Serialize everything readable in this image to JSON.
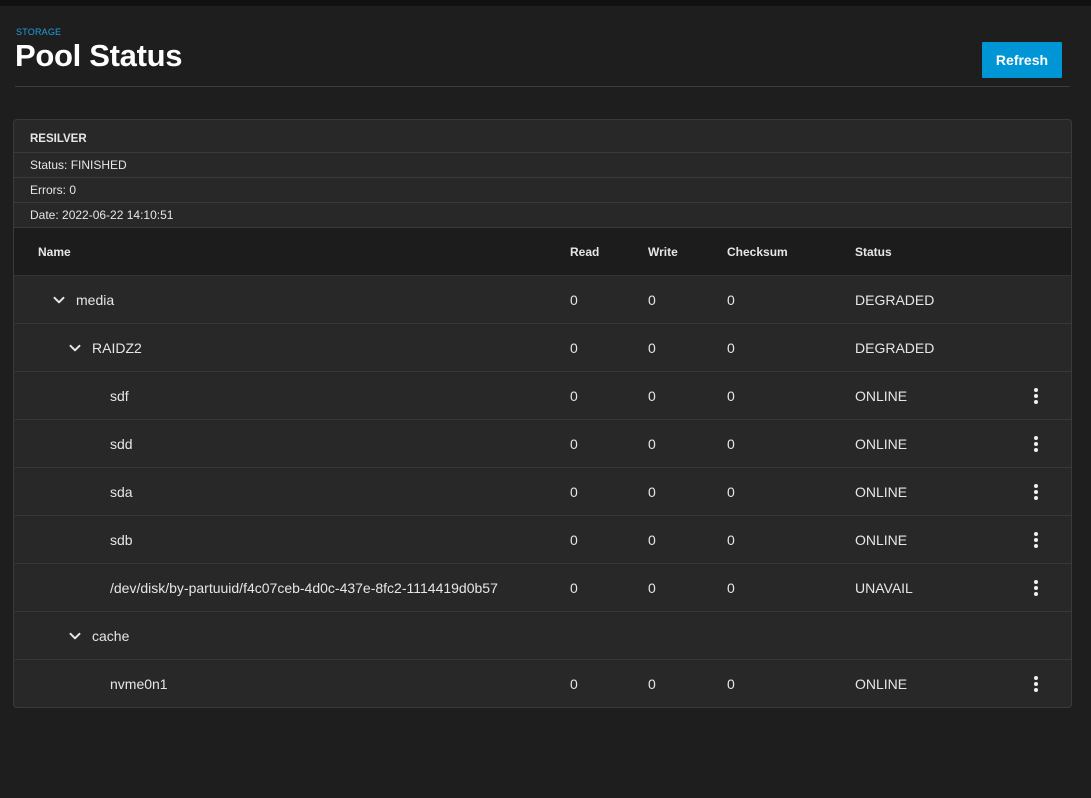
{
  "header": {
    "breadcrumb": "STORAGE",
    "title": "Pool Status",
    "refresh_label": "Refresh"
  },
  "resilver": {
    "title": "RESILVER",
    "status": "Status: FINISHED",
    "errors": "Errors: 0",
    "date": "Date: 2022-06-22 14:10:51"
  },
  "table": {
    "columns": {
      "name": "Name",
      "read": "Read",
      "write": "Write",
      "checksum": "Checksum",
      "status": "Status"
    },
    "rows": [
      {
        "name": "media",
        "level": 0,
        "expandable": true,
        "read": "0",
        "write": "0",
        "checksum": "0",
        "status": "DEGRADED",
        "menu": false
      },
      {
        "name": "RAIDZ2",
        "level": 1,
        "expandable": true,
        "read": "0",
        "write": "0",
        "checksum": "0",
        "status": "DEGRADED",
        "menu": false
      },
      {
        "name": "sdf",
        "level": 2,
        "expandable": false,
        "read": "0",
        "write": "0",
        "checksum": "0",
        "status": "ONLINE",
        "menu": true
      },
      {
        "name": "sdd",
        "level": 2,
        "expandable": false,
        "read": "0",
        "write": "0",
        "checksum": "0",
        "status": "ONLINE",
        "menu": true
      },
      {
        "name": "sda",
        "level": 2,
        "expandable": false,
        "read": "0",
        "write": "0",
        "checksum": "0",
        "status": "ONLINE",
        "menu": true
      },
      {
        "name": "sdb",
        "level": 2,
        "expandable": false,
        "read": "0",
        "write": "0",
        "checksum": "0",
        "status": "ONLINE",
        "menu": true
      },
      {
        "name": "/dev/disk/by-partuuid/f4c07ceb-4d0c-437e-8fc2-1114419d0b57",
        "level": 2,
        "expandable": false,
        "read": "0",
        "write": "0",
        "checksum": "0",
        "status": "UNAVAIL",
        "menu": true
      },
      {
        "name": "cache",
        "level": 1,
        "expandable": true,
        "read": "",
        "write": "",
        "checksum": "",
        "status": "",
        "menu": false
      },
      {
        "name": "nvme0n1",
        "level": 2,
        "expandable": false,
        "read": "0",
        "write": "0",
        "checksum": "0",
        "status": "ONLINE",
        "menu": true
      }
    ]
  },
  "icons": {
    "expand": "chevron-down-icon",
    "row_menu": "more-vertical-icon"
  },
  "colors": {
    "accent": "#0095d5",
    "breadcrumb": "#1fa0e0",
    "background": "#1e1e1e",
    "card": "#282828"
  }
}
